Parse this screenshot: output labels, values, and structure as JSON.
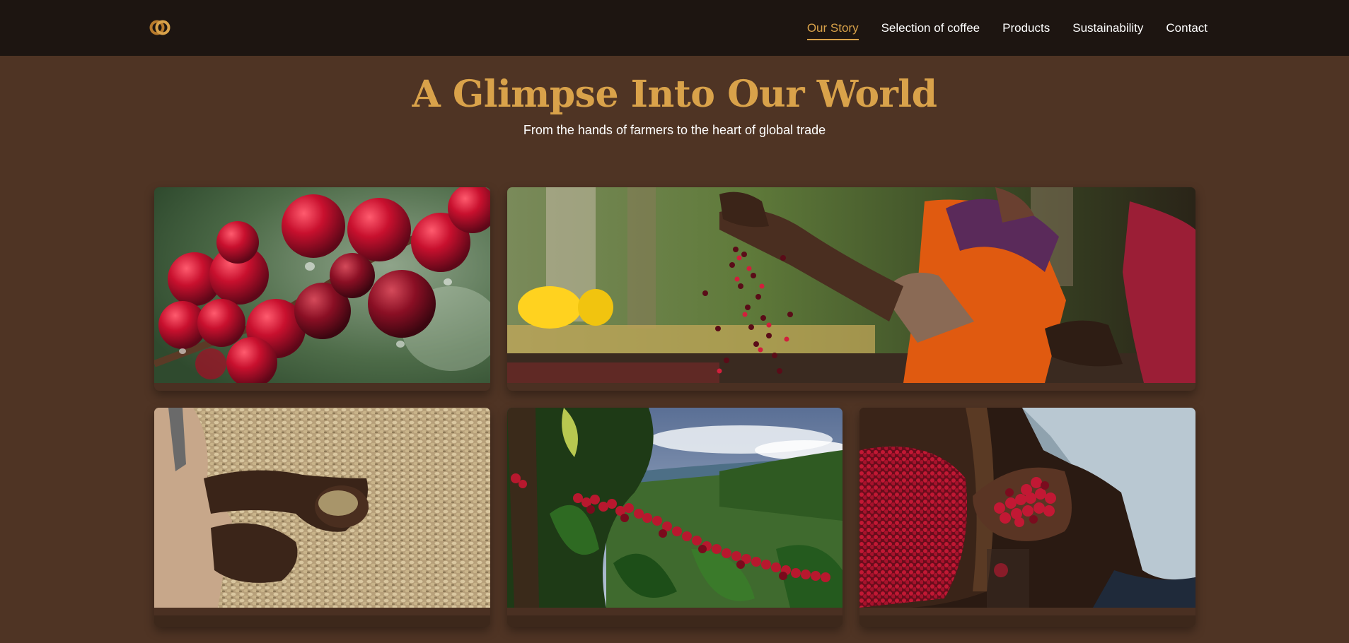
{
  "nav": {
    "logo": "logo-icon",
    "links": [
      "Our Story",
      "Selection of coffee",
      "Products",
      "Sustainability",
      "Contact"
    ],
    "active": "Our Story"
  },
  "hero": {
    "title": "A Glimpse Into Our World",
    "subtitle": "From the hands of farmers to the heart of global trade"
  },
  "gallery": [
    {
      "image": "coffee-cherries-on-branch"
    },
    {
      "image": "farmers-tossing-coffee-cherries"
    },
    {
      "image": "hands-holding-green-coffee-beans"
    },
    {
      "image": "coffee-plant-mountain-landscape"
    },
    {
      "image": "hand-holding-red-coffee-cherries-basket"
    }
  ],
  "colors": {
    "background": "#4f3424",
    "navbar": "#1d1511",
    "accent": "#d9a24a",
    "text": "#ffffff"
  }
}
